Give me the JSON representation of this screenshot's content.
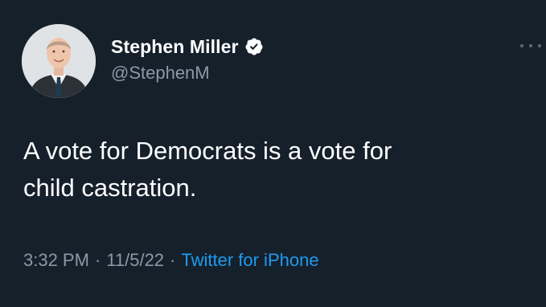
{
  "tweet": {
    "author": {
      "display_name": "Stephen Miller",
      "handle": "@StephenM",
      "verified": true,
      "avatar_icon": "profile-photo"
    },
    "more_icon": "more-horizontal-icon",
    "text": "A vote for Democrats is a vote for\nchild castration.",
    "meta": {
      "time": "3:32 PM",
      "date": "11/5/22",
      "source": "Twitter for iPhone",
      "separator": "·"
    }
  },
  "colors": {
    "background": "#15202b",
    "primary_text": "#ffffff",
    "secondary_text": "#8b98a5",
    "link": "#1d9bf0",
    "verified_badge": "#ffffff"
  }
}
